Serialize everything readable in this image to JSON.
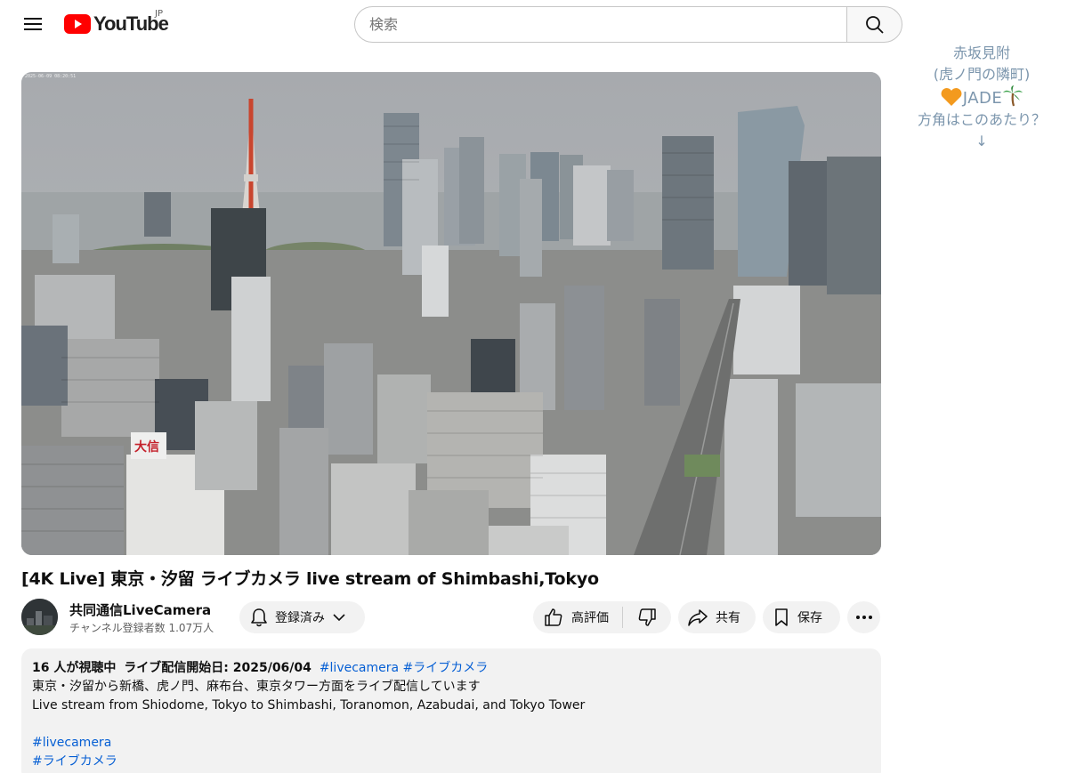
{
  "header": {
    "logo_text": "YouTube",
    "region": "JP",
    "search_placeholder": "検索"
  },
  "annotation": {
    "line1": "赤坂見附",
    "line2": "(虎ノ門の隣町)",
    "line3": "JADE",
    "line4": "方角はこのあたり？",
    "arrow": "↓"
  },
  "video": {
    "stamp": "2025-06-09 08:20:51",
    "title": "[4K Live] 東京・汐留 ライブカメラ live stream of Shimbashi,Tokyo",
    "building_sign": "大信"
  },
  "channel": {
    "name": "共同通信LiveCamera",
    "subscribers": "チャンネル登録者数 1.07万人",
    "subscribe_label": "登録済み"
  },
  "actions": {
    "like_label": "高評価",
    "share_label": "共有",
    "save_label": "保存"
  },
  "description": {
    "viewers": "16 人が視聴中",
    "started": "ライブ配信開始日: 2025/06/04",
    "tag1": "#livecamera",
    "tag2": "#ライブカメラ",
    "line_jp": "東京・汐留から新橋、虎ノ門、麻布台、東京タワー方面をライブ配信しています",
    "line_en": "Live stream from Shiodome, Tokyo to Shimbashi, Toranomon, Azabudai, and Tokyo Tower",
    "tag3": "#livecamera",
    "tag4": "#ライブカメラ"
  },
  "colors": {
    "brand_red": "#ff0000",
    "link_blue": "#065fd4",
    "annotation_blue": "#7c96ad",
    "heart_orange": "#f39a1e"
  }
}
